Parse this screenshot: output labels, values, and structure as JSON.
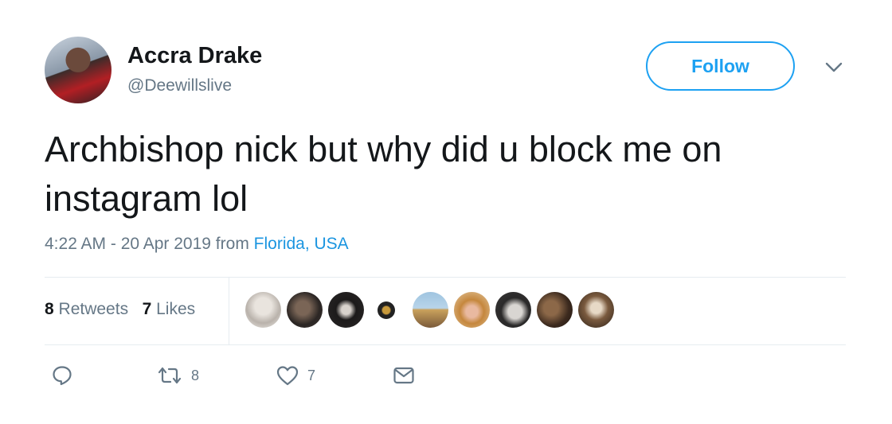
{
  "user": {
    "name": "Accra Drake",
    "handle": "@Deewillslive",
    "follow_label": "Follow"
  },
  "tweet": {
    "text_line1": "Archbishop nick but why did u block me on",
    "text_line2": "instagram lol",
    "time": "4:22 AM - 20 Apr 2019 from ",
    "location": "Florida, USA"
  },
  "stats": {
    "retweets_count": "8",
    "retweets_label": "Retweets",
    "likes_count": "7",
    "likes_label": "Likes"
  },
  "actions": {
    "reply_icon": "reply-icon",
    "retweet_icon": "retweet-icon",
    "retweet_count": "8",
    "like_icon": "heart-icon",
    "like_count": "7",
    "dm_icon": "envelope-icon"
  },
  "colors": {
    "accent": "#1da1f2",
    "link": "#1b95e0",
    "muted": "#657786",
    "text": "#14171a"
  }
}
